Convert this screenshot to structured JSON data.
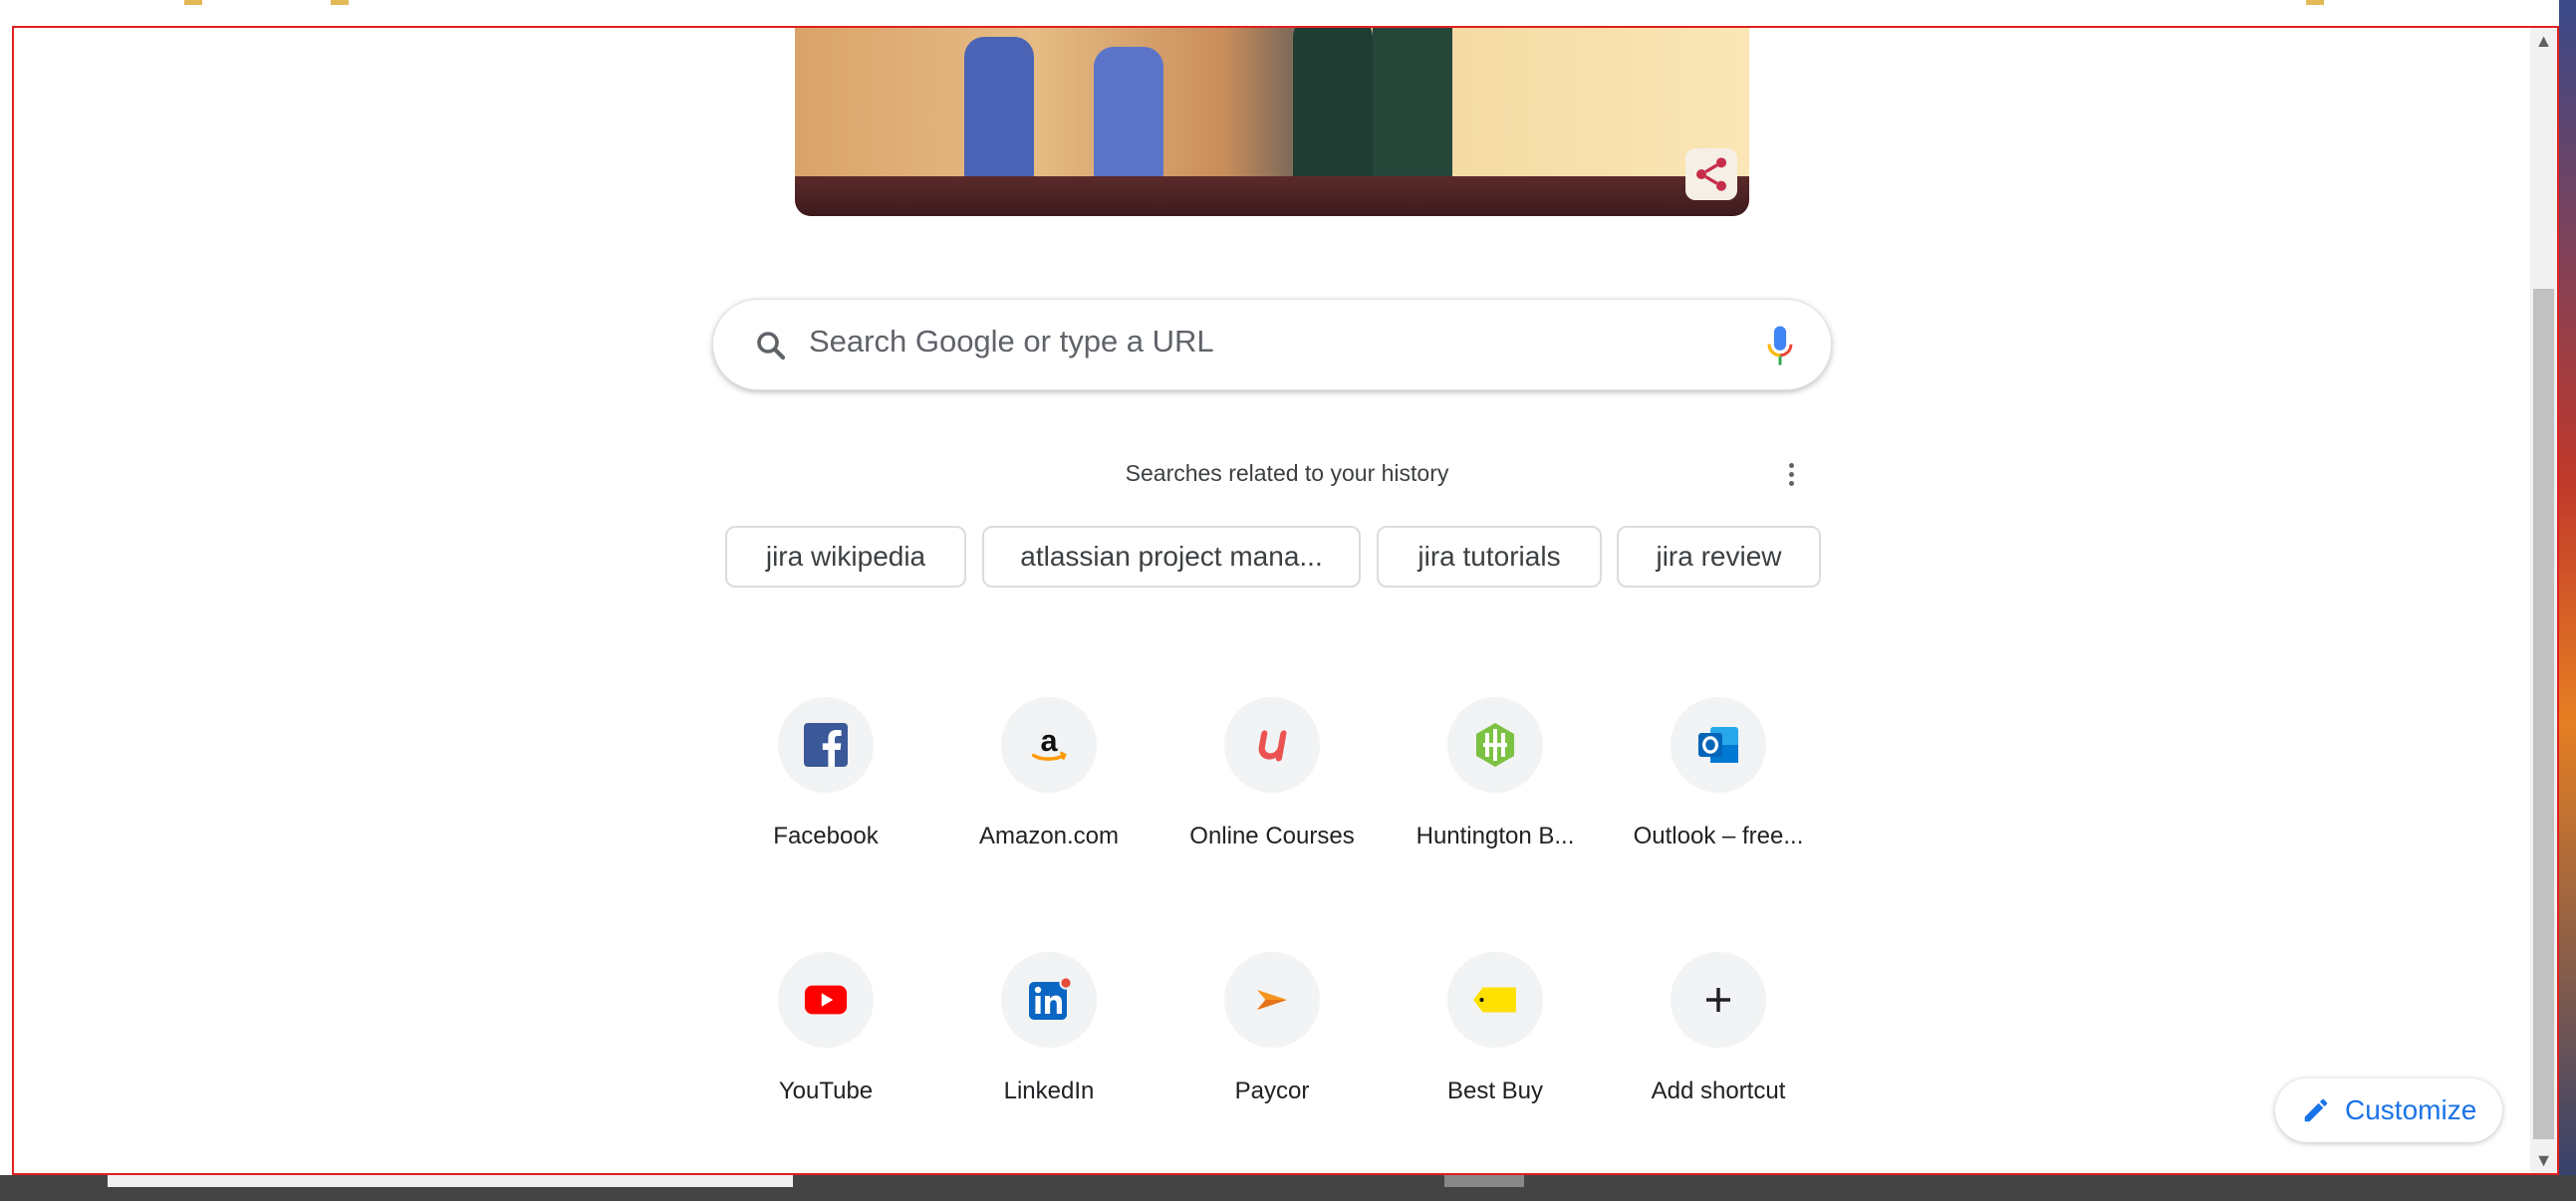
{
  "search": {
    "placeholder": "Search Google or type a URL"
  },
  "related": {
    "title": "Searches related to your history",
    "chips": [
      "jira wikipedia",
      "atlassian project mana...",
      "jira tutorials",
      "jira review"
    ]
  },
  "shortcuts": [
    {
      "label": "Facebook",
      "icon": "facebook-icon"
    },
    {
      "label": "Amazon.com",
      "icon": "amazon-icon"
    },
    {
      "label": "Online Courses",
      "icon": "udemy-icon"
    },
    {
      "label": "Huntington B...",
      "icon": "huntington-icon"
    },
    {
      "label": "Outlook – free...",
      "icon": "outlook-icon"
    },
    {
      "label": "YouTube",
      "icon": "youtube-icon"
    },
    {
      "label": "LinkedIn",
      "icon": "linkedin-icon"
    },
    {
      "label": "Paycor",
      "icon": "paycor-icon"
    },
    {
      "label": "Best Buy",
      "icon": "bestbuy-icon"
    },
    {
      "label": "Add shortcut",
      "icon": "plus-icon"
    }
  ],
  "customize": {
    "label": "Customize"
  },
  "colors": {
    "accent": "#1a73e8",
    "frame_border": "#e02020",
    "youtube": "#ff0000",
    "facebook": "#3b5998",
    "linkedin": "#0a66c2"
  }
}
